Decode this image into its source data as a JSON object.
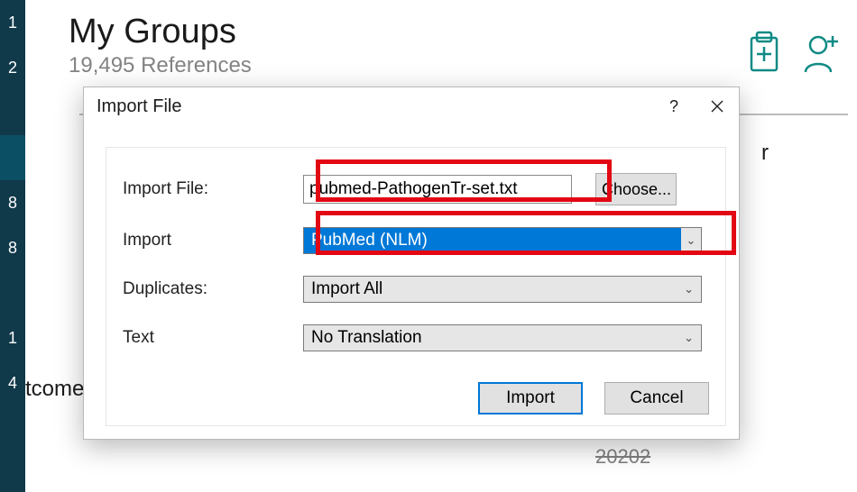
{
  "sidebar": {
    "items": [
      {
        "label": "1"
      },
      {
        "label": "2"
      },
      {
        "label": ""
      },
      {
        "label": ""
      },
      {
        "label": "8"
      },
      {
        "label": "8"
      },
      {
        "label": ""
      },
      {
        "label": "1"
      },
      {
        "label": "4"
      }
    ]
  },
  "header": {
    "title": "My Groups",
    "subtitle": "19,495 References"
  },
  "background": {
    "right_fragment": "r",
    "left_fragment": "tcomes",
    "number": "20202"
  },
  "dialog": {
    "title": "Import File",
    "help": "?",
    "close": "✕",
    "labels": {
      "file": "Import File:",
      "option": "Import",
      "duplicates": "Duplicates:",
      "text": "Text"
    },
    "file_value": "pubmed-PathogenTr-set.txt",
    "choose": "Choose...",
    "option_value": "PubMed (NLM)",
    "duplicates_value": "Import All",
    "text_value": "No Translation",
    "buttons": {
      "import": "Import",
      "cancel": "Cancel"
    }
  }
}
